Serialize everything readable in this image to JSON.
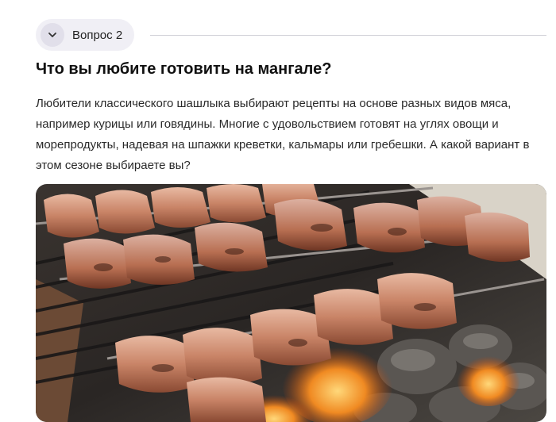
{
  "question": {
    "toggle_label": "Вопрос 2",
    "toggle_icon": "chevron-down-icon",
    "title": "Что вы любите готовить на мангале?",
    "body": "Любители классического шашлыка выбирают рецепты на основе разных видов мяса, например курицы или говядины. Многие с удовольствием готовят на углях овощи и морепродукты, надевая на шпажки креветки, кальмары или гребешки. А какой вариант в этом сезоне выбираете вы?"
  },
  "image": {
    "subject": "grilled-meat-skewers"
  },
  "colors": {
    "pill_bg": "#f0eff5",
    "chevron_bg": "#e1dfea",
    "divider": "#cfcfd6"
  }
}
